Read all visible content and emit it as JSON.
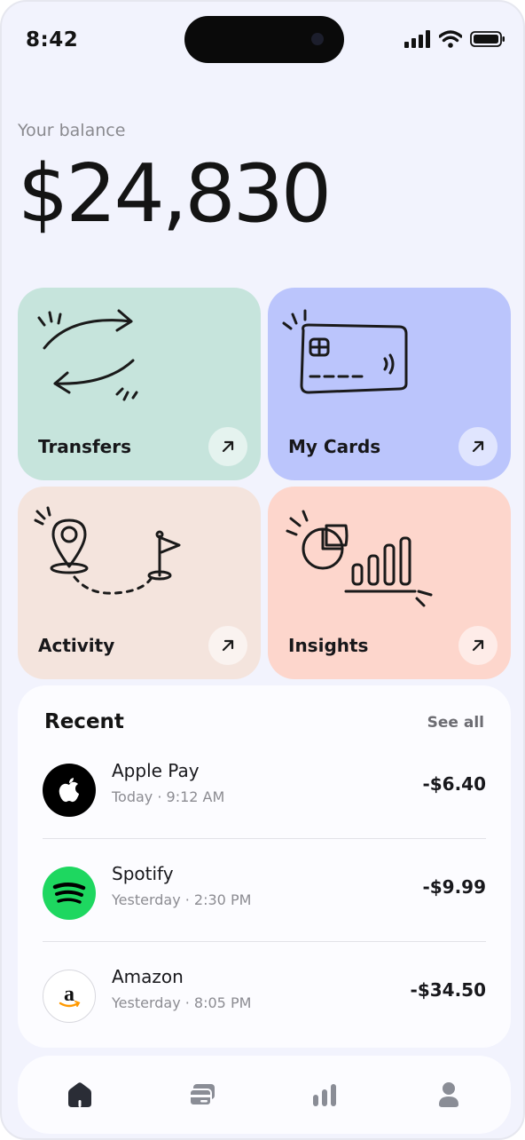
{
  "status_bar": {
    "time": "8:42",
    "icons": [
      "signal-icon",
      "wifi-icon",
      "battery-icon"
    ]
  },
  "balance": {
    "label": "Your balance",
    "value": "$24,830"
  },
  "tiles": [
    {
      "label": "Transfers",
      "color": "#c6e4dc",
      "icon": "transfer-arrows-icon"
    },
    {
      "label": "My Cards",
      "color": "#bbc5fc",
      "icon": "credit-card-icon"
    },
    {
      "label": "Activity",
      "color": "#f4e4dd",
      "icon": "route-pin-icon"
    },
    {
      "label": "Insights",
      "color": "#fdd6cc",
      "icon": "chart-icon"
    }
  ],
  "recent": {
    "title": "Recent",
    "see_all": "See all",
    "transactions": [
      {
        "name": "Apple Pay",
        "meta": "Today · 9:12 AM",
        "amount": "-$6.40",
        "icon": "apple-icon"
      },
      {
        "name": "Spotify",
        "meta": "Yesterday · 2:30 PM",
        "amount": "-$9.99",
        "icon": "spotify-icon"
      },
      {
        "name": "Amazon",
        "meta": "Yesterday · 8:05 PM",
        "amount": "-$34.50",
        "icon": "amazon-icon"
      }
    ]
  },
  "nav": {
    "items": [
      "home-icon",
      "cards-icon",
      "stats-icon",
      "profile-icon"
    ],
    "active": "home-icon"
  }
}
